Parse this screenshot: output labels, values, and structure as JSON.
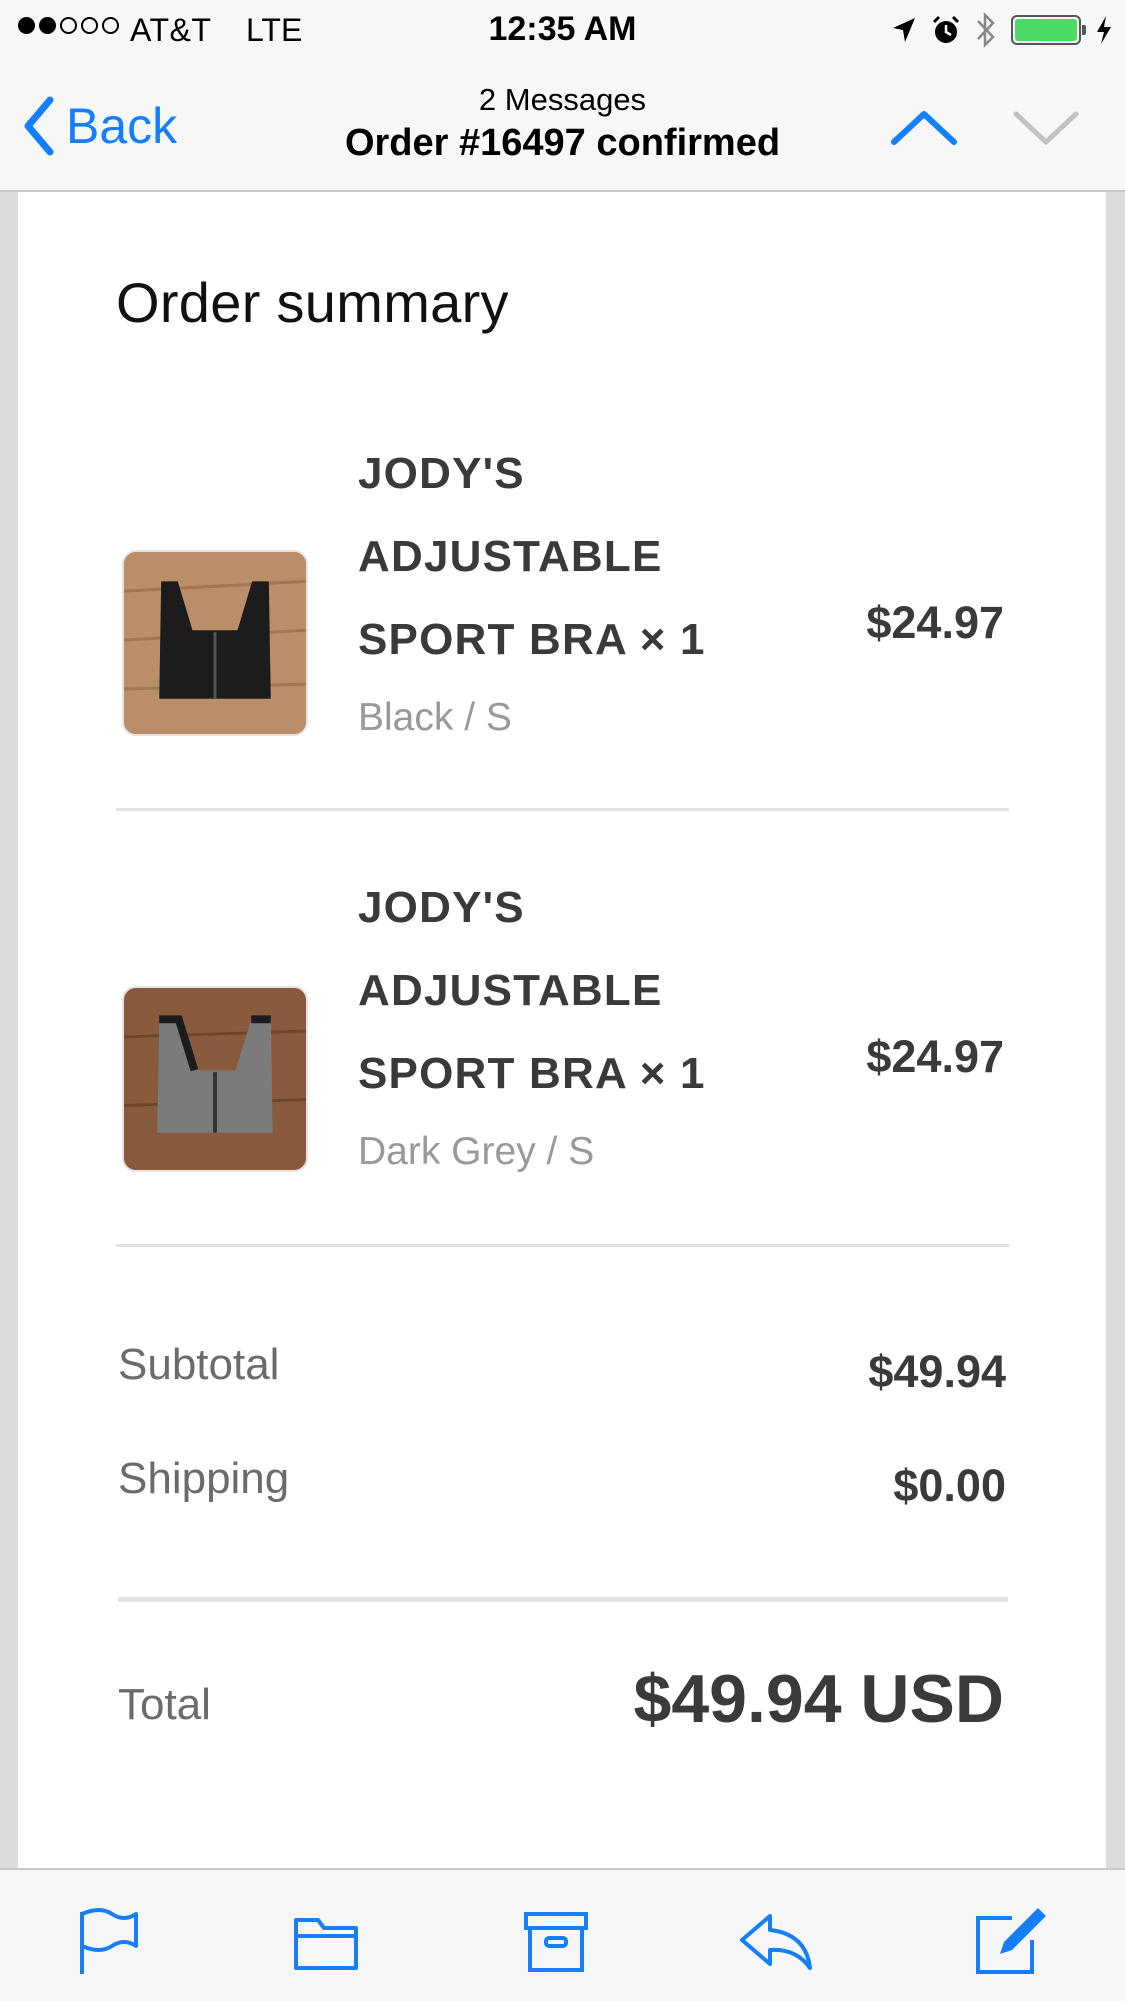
{
  "status_bar": {
    "carrier": "AT&T",
    "network": "LTE",
    "time": "12:35 AM",
    "battery_color": "#4cd964"
  },
  "nav": {
    "back_label": "Back",
    "subtitle": "2 Messages",
    "title": "Order #16497 confirmed",
    "accent": "#157efb"
  },
  "order": {
    "heading": "Order summary",
    "items": [
      {
        "name": "JODY'S ADJUSTABLE SPORT BRA × 1",
        "variant": "Black / S",
        "price": "$24.97",
        "thumb_icon": "black-sport-bra-photo"
      },
      {
        "name": "JODY'S ADJUSTABLE SPORT BRA × 1",
        "variant": "Dark Grey / S",
        "price": "$24.97",
        "thumb_icon": "grey-sport-bra-photo"
      }
    ],
    "subtotal_label": "Subtotal",
    "subtotal": "$49.94",
    "shipping_label": "Shipping",
    "shipping": "$0.00",
    "total_label": "Total",
    "total": "$49.94 USD"
  },
  "toolbar": {
    "icons": [
      "flag-icon",
      "folder-icon",
      "archive-icon",
      "reply-icon",
      "compose-icon"
    ]
  }
}
